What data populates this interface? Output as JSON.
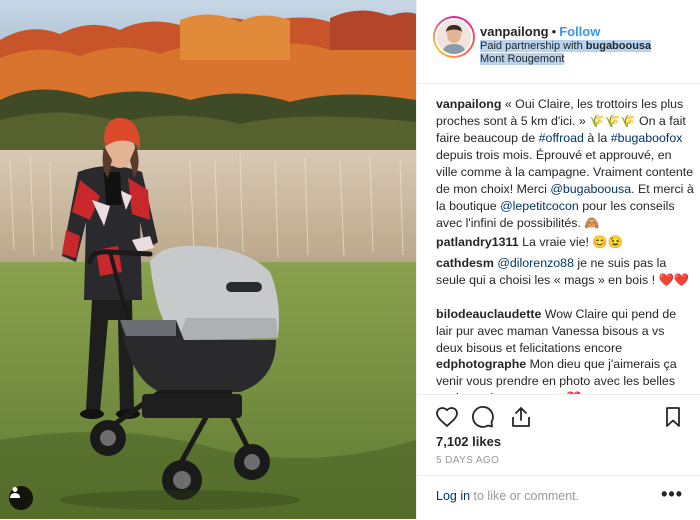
{
  "header": {
    "username": "vanpailong",
    "separator": "•",
    "follow_label": "Follow",
    "partnership_prefix": "Paid partnership with ",
    "partner": "bugaboousa",
    "location": "Mont Rougemont"
  },
  "comments": [
    {
      "user": "vanpailong",
      "parts": [
        {
          "t": " « Oui Claire, les trottoirs les plus proches sont à 5 km d'ici. » "
        },
        {
          "t": "🌾🌾🌾"
        },
        {
          "t": " On a fait faire beaucoup de "
        },
        {
          "t": "#offroad",
          "link": true
        },
        {
          "t": " à la "
        },
        {
          "t": "#bugaboofox",
          "link": true
        },
        {
          "t": " depuis trois mois. Éprouvé et approuvé, en ville comme à la campagne. Vraiment contente de mon choix! Merci "
        },
        {
          "t": "@bugaboousa",
          "link": true
        },
        {
          "t": ". Et merci à la boutique "
        },
        {
          "t": "@lepetitcocon",
          "link": true
        },
        {
          "t": " pour les conseils avec l'infini de possibilités. 🙈"
        }
      ]
    },
    {
      "user": "patlandry1311",
      "parts": [
        {
          "t": " La vraie vie! 😊😉"
        }
      ]
    },
    {
      "user": "cathdesm",
      "parts": [
        {
          "t": " "
        },
        {
          "t": "@dilorenzo88",
          "link": true
        },
        {
          "t": " je ne suis pas la seule qui a choisi les « mags » en bois ! ❤️❤️"
        }
      ]
    },
    {
      "user": "bilodeauclaudette",
      "parts": [
        {
          "t": " Wow Claire qui pend de lair pur avec maman Vanessa bisous a vs deux bisous et felicitations encore"
        }
      ]
    },
    {
      "user": "edphotographe",
      "parts": [
        {
          "t": " Mon dieu que j'aimerais ça venir vous prendre en photo avec les belles couleurs de rougemont ❤️"
        }
      ]
    }
  ],
  "actions": {
    "like_icon": "heart-icon",
    "comment_icon": "comment-icon",
    "share_icon": "share-icon",
    "save_icon": "bookmark-icon",
    "likes": "7,102 likes",
    "date": "5 DAYS AGO"
  },
  "footer": {
    "login_link": "Log in",
    "login_rest": " to like or comment.",
    "more_label": "•••"
  },
  "colors": {
    "accent": "#3897f0",
    "link": "#003569",
    "muted": "#999999",
    "highlight": "#b7d3ef"
  }
}
